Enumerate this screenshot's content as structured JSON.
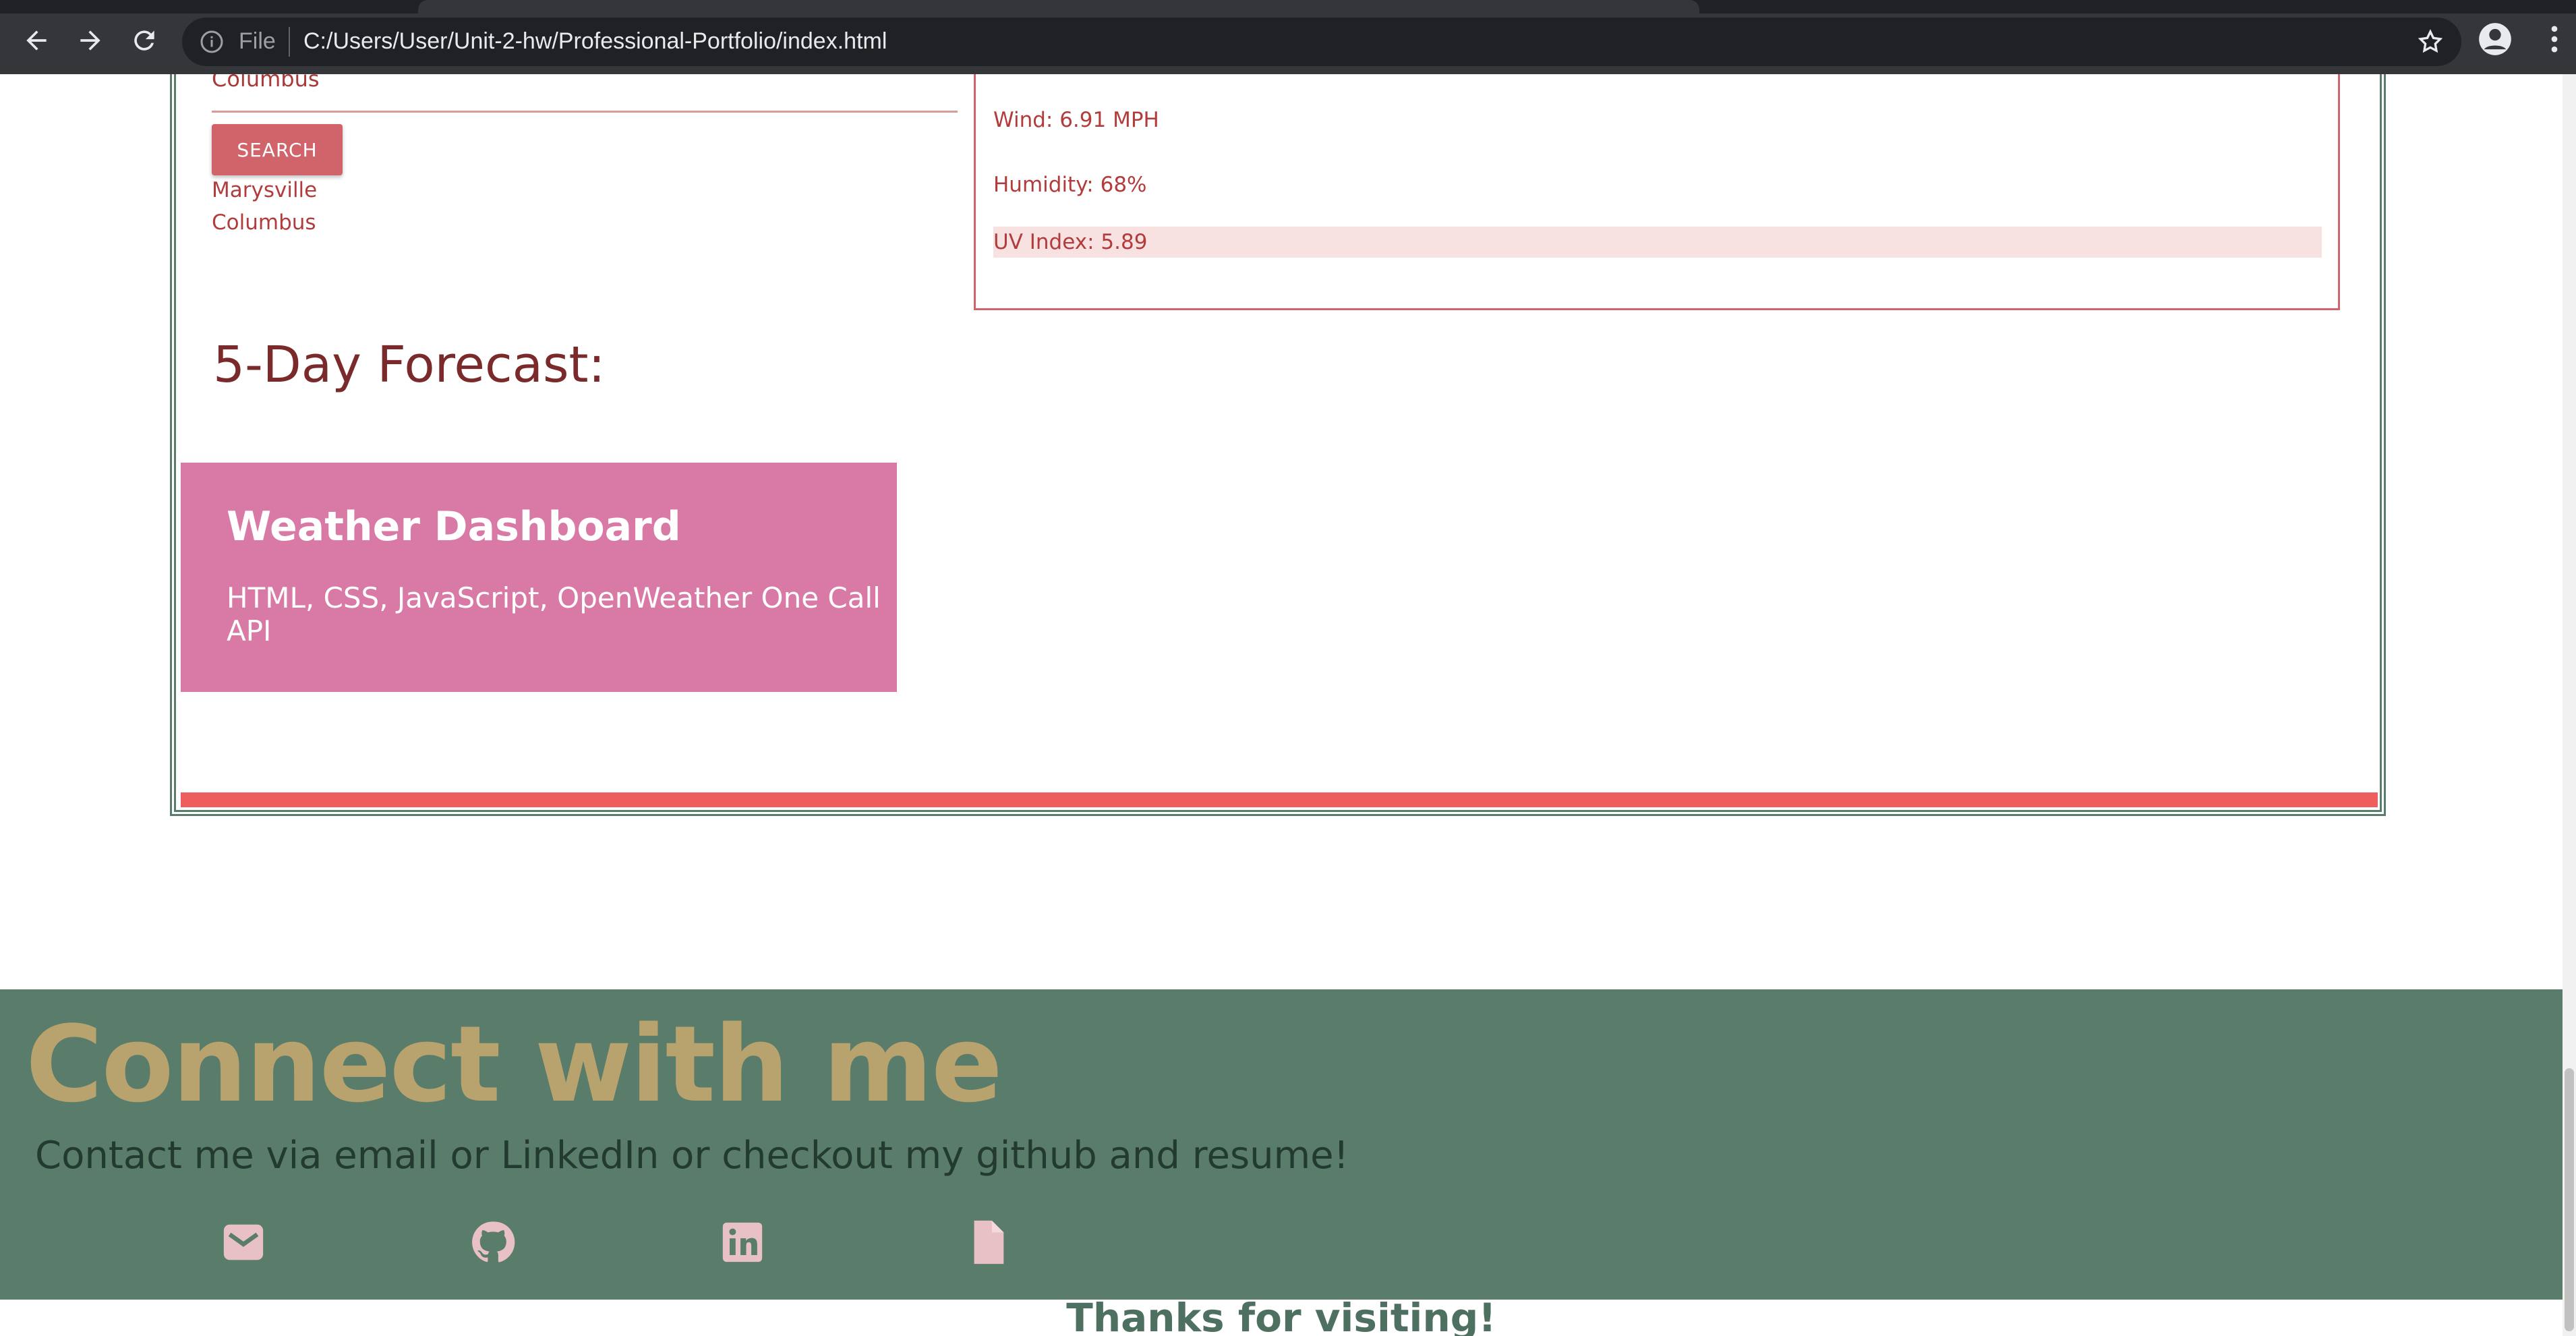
{
  "browser": {
    "scheme_label": "File",
    "url": "C:/Users/User/Unit-2-hw/Professional-Portfolio/index.html",
    "icons": [
      "back-icon",
      "forward-icon",
      "reload-icon",
      "info-icon",
      "star-icon",
      "profile-icon",
      "menu-icon"
    ]
  },
  "weather": {
    "city_value": "Columbus",
    "search_label": "SEARCH",
    "history": [
      "Marysville",
      "Columbus"
    ],
    "wind": "Wind: 6.91 MPH",
    "humidity": "Humidity: 68%",
    "uv_index": "UV Index: 5.89",
    "forecast_title": "5-Day Forecast:"
  },
  "project": {
    "title": "Weather Dashboard",
    "tech": "HTML, CSS, JavaScript, OpenWeather One Call API"
  },
  "contact": {
    "title": "Connect with me",
    "text": "Contact me via email or LinkedIn or checkout my github and resume!",
    "icons": [
      "email-icon",
      "github-icon",
      "linkedin-icon",
      "resume-icon"
    ]
  },
  "footer": {
    "thanks": "Thanks for visiting!"
  },
  "colors": {
    "chrome_bg": "#35363a",
    "accent_red": "#ee5e5e",
    "card_pink": "#d97aa6",
    "contact_green": "#5a7c6b",
    "contact_gold": "#b8a36e"
  }
}
